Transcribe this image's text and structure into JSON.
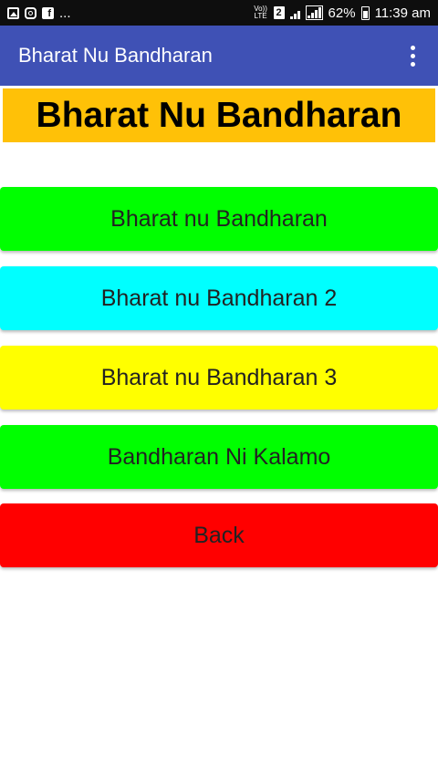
{
  "status_bar": {
    "notification_more": "...",
    "volte_top": "Vo))",
    "volte_bottom": "LTE",
    "sim_slot": "2",
    "battery_percent": "62%",
    "time": "11:39 am"
  },
  "app_bar": {
    "title": "Bharat Nu Bandharan"
  },
  "banner": {
    "text": "Bharat Nu Bandharan",
    "color": "#ffc107"
  },
  "menu": {
    "items": [
      {
        "label": "Bharat nu Bandharan",
        "color": "#00ff00"
      },
      {
        "label": "Bharat nu Bandharan 2",
        "color": "#00ffff"
      },
      {
        "label": "Bharat nu Bandharan 3",
        "color": "#ffff00"
      },
      {
        "label": "Bandharan Ni Kalamo",
        "color": "#00ff00"
      },
      {
        "label": "Back",
        "color": "#ff0000"
      }
    ]
  },
  "colors": {
    "app_bar": "#3f51b5",
    "status_bar": "#0e0e0e"
  }
}
